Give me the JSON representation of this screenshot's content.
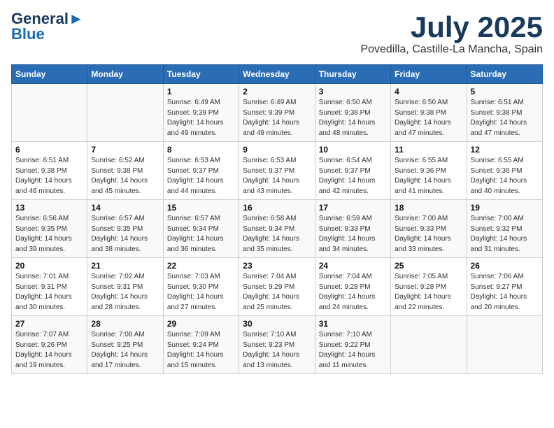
{
  "header": {
    "logo_line1": "General",
    "logo_line2": "Blue",
    "month": "July 2025",
    "location": "Povedilla, Castille-La Mancha, Spain"
  },
  "days_of_week": [
    "Sunday",
    "Monday",
    "Tuesday",
    "Wednesday",
    "Thursday",
    "Friday",
    "Saturday"
  ],
  "weeks": [
    [
      {
        "day": "",
        "info": ""
      },
      {
        "day": "",
        "info": ""
      },
      {
        "day": "1",
        "info": "Sunrise: 6:49 AM\nSunset: 9:39 PM\nDaylight: 14 hours and 49 minutes."
      },
      {
        "day": "2",
        "info": "Sunrise: 6:49 AM\nSunset: 9:39 PM\nDaylight: 14 hours and 49 minutes."
      },
      {
        "day": "3",
        "info": "Sunrise: 6:50 AM\nSunset: 9:38 PM\nDaylight: 14 hours and 48 minutes."
      },
      {
        "day": "4",
        "info": "Sunrise: 6:50 AM\nSunset: 9:38 PM\nDaylight: 14 hours and 47 minutes."
      },
      {
        "day": "5",
        "info": "Sunrise: 6:51 AM\nSunset: 9:38 PM\nDaylight: 14 hours and 47 minutes."
      }
    ],
    [
      {
        "day": "6",
        "info": "Sunrise: 6:51 AM\nSunset: 9:38 PM\nDaylight: 14 hours and 46 minutes."
      },
      {
        "day": "7",
        "info": "Sunrise: 6:52 AM\nSunset: 9:38 PM\nDaylight: 14 hours and 45 minutes."
      },
      {
        "day": "8",
        "info": "Sunrise: 6:53 AM\nSunset: 9:37 PM\nDaylight: 14 hours and 44 minutes."
      },
      {
        "day": "9",
        "info": "Sunrise: 6:53 AM\nSunset: 9:37 PM\nDaylight: 14 hours and 43 minutes."
      },
      {
        "day": "10",
        "info": "Sunrise: 6:54 AM\nSunset: 9:37 PM\nDaylight: 14 hours and 42 minutes."
      },
      {
        "day": "11",
        "info": "Sunrise: 6:55 AM\nSunset: 9:36 PM\nDaylight: 14 hours and 41 minutes."
      },
      {
        "day": "12",
        "info": "Sunrise: 6:55 AM\nSunset: 9:36 PM\nDaylight: 14 hours and 40 minutes."
      }
    ],
    [
      {
        "day": "13",
        "info": "Sunrise: 6:56 AM\nSunset: 9:35 PM\nDaylight: 14 hours and 39 minutes."
      },
      {
        "day": "14",
        "info": "Sunrise: 6:57 AM\nSunset: 9:35 PM\nDaylight: 14 hours and 38 minutes."
      },
      {
        "day": "15",
        "info": "Sunrise: 6:57 AM\nSunset: 9:34 PM\nDaylight: 14 hours and 36 minutes."
      },
      {
        "day": "16",
        "info": "Sunrise: 6:58 AM\nSunset: 9:34 PM\nDaylight: 14 hours and 35 minutes."
      },
      {
        "day": "17",
        "info": "Sunrise: 6:59 AM\nSunset: 9:33 PM\nDaylight: 14 hours and 34 minutes."
      },
      {
        "day": "18",
        "info": "Sunrise: 7:00 AM\nSunset: 9:33 PM\nDaylight: 14 hours and 33 minutes."
      },
      {
        "day": "19",
        "info": "Sunrise: 7:00 AM\nSunset: 9:32 PM\nDaylight: 14 hours and 31 minutes."
      }
    ],
    [
      {
        "day": "20",
        "info": "Sunrise: 7:01 AM\nSunset: 9:31 PM\nDaylight: 14 hours and 30 minutes."
      },
      {
        "day": "21",
        "info": "Sunrise: 7:02 AM\nSunset: 9:31 PM\nDaylight: 14 hours and 28 minutes."
      },
      {
        "day": "22",
        "info": "Sunrise: 7:03 AM\nSunset: 9:30 PM\nDaylight: 14 hours and 27 minutes."
      },
      {
        "day": "23",
        "info": "Sunrise: 7:04 AM\nSunset: 9:29 PM\nDaylight: 14 hours and 25 minutes."
      },
      {
        "day": "24",
        "info": "Sunrise: 7:04 AM\nSunset: 9:28 PM\nDaylight: 14 hours and 24 minutes."
      },
      {
        "day": "25",
        "info": "Sunrise: 7:05 AM\nSunset: 9:28 PM\nDaylight: 14 hours and 22 minutes."
      },
      {
        "day": "26",
        "info": "Sunrise: 7:06 AM\nSunset: 9:27 PM\nDaylight: 14 hours and 20 minutes."
      }
    ],
    [
      {
        "day": "27",
        "info": "Sunrise: 7:07 AM\nSunset: 9:26 PM\nDaylight: 14 hours and 19 minutes."
      },
      {
        "day": "28",
        "info": "Sunrise: 7:08 AM\nSunset: 9:25 PM\nDaylight: 14 hours and 17 minutes."
      },
      {
        "day": "29",
        "info": "Sunrise: 7:09 AM\nSunset: 9:24 PM\nDaylight: 14 hours and 15 minutes."
      },
      {
        "day": "30",
        "info": "Sunrise: 7:10 AM\nSunset: 9:23 PM\nDaylight: 14 hours and 13 minutes."
      },
      {
        "day": "31",
        "info": "Sunrise: 7:10 AM\nSunset: 9:22 PM\nDaylight: 14 hours and 11 minutes."
      },
      {
        "day": "",
        "info": ""
      },
      {
        "day": "",
        "info": ""
      }
    ]
  ]
}
